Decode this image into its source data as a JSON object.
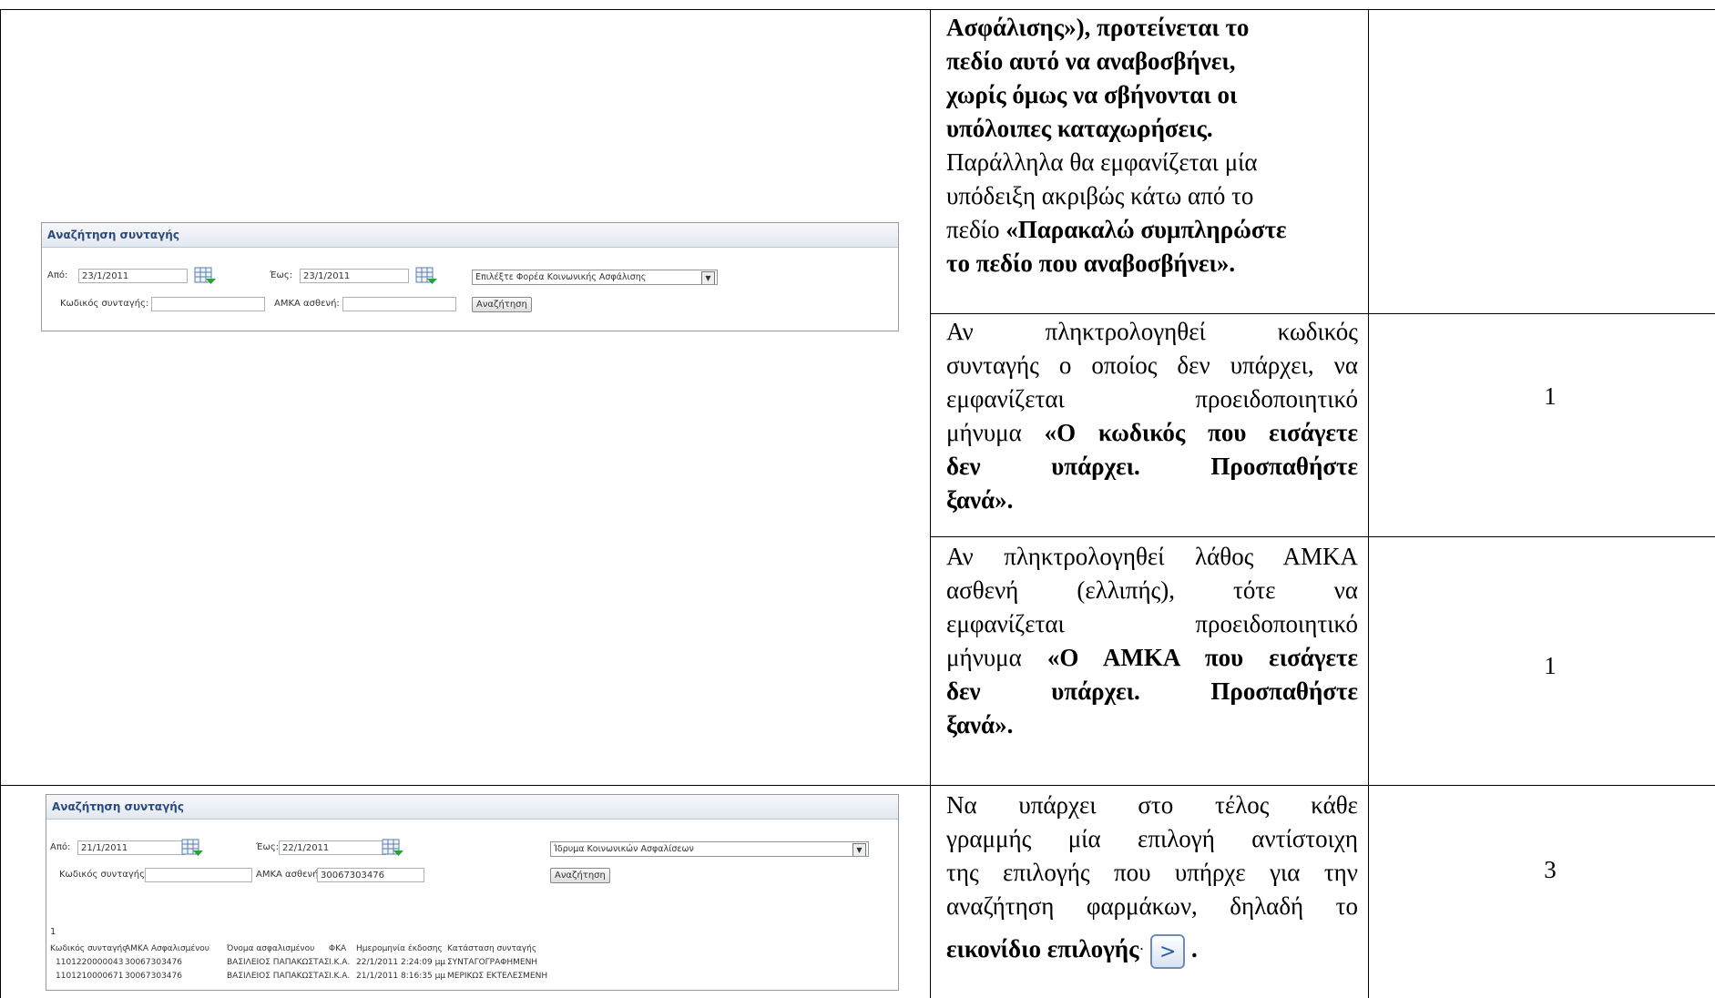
{
  "row1": {
    "text_lines": [
      {
        "b": "Ασφάλισης»), προτείνεται το"
      },
      {
        "b": "πεδίο αυτό να αναβοσβήνει,"
      },
      {
        "b": "χωρίς όμως να σβήνονται οι"
      },
      {
        "b": "υπόλοιπες καταχωρήσεις."
      },
      {
        "t": "Παράλληλα θα εμφανίζεται μία"
      },
      {
        "t": "υπόδειξη ακριβώς κάτω από το"
      }
    ],
    "line7_plain": "πεδίο ",
    "line7_bold": "«Παρακαλώ συμπληρώστε",
    "line8_bold": "το πεδίο που αναβοσβήνει».",
    "number": ""
  },
  "search_form_1": {
    "title": "Αναζήτηση συνταγής",
    "from_label": "Από:",
    "from_value": "23/1/2011",
    "to_label": "Έως:",
    "to_value": "23/1/2011",
    "fund_select": "Επιλέξτε Φορέα Κοινωνικής Ασφάλισης",
    "code_label": "Κωδικός συνταγής:",
    "code_value": "",
    "amka_label": "ΑΜΚΑ ασθενή:",
    "amka_value": "",
    "search_button": "Αναζήτηση"
  },
  "row2": {
    "l1a": "Αν",
    "l1b": "πληκτρολογηθεί",
    "l1c": "κωδικός",
    "l2": "συνταγής ο οποίος δεν υπάρχει, να",
    "l3a": "εμφανίζεται",
    "l3b": "προειδοποιητικό",
    "l4_plain": "μήνυμα ",
    "l4_bold": "«Ο κωδικός που εισάγετε",
    "l5a": "δεν",
    "l5b": "υπάρχει.",
    "l5c": "Προσπαθήστε",
    "l6": "ξανά».",
    "number": "1"
  },
  "row3": {
    "l1": "Αν πληκτρολογηθεί λάθος ΑΜΚΑ",
    "l2a": "ασθενή",
    "l2b": "(ελλιπής),",
    "l2c": "τότε",
    "l2d": "να",
    "l3a": "εμφανίζεται",
    "l3b": "προειδοποιητικό",
    "l4_plain": "μήνυμα ",
    "l4_bold": "«Ο ΑΜΚΑ που εισάγετε",
    "l5a": "δεν",
    "l5b": "υπάρχει.",
    "l5c": "Προσπαθήστε",
    "l6": "ξανά».",
    "number": "1"
  },
  "search_form_2": {
    "title": "Αναζήτηση συνταγής",
    "from_label": "Από:",
    "from_value": "21/1/2011",
    "to_label": "Έως:",
    "to_value": "22/1/2011",
    "fund_select": "Ίδρυμα Κοινωνικών Ασφαλίσεων",
    "code_label": "Κωδικός συνταγής:",
    "code_value": "",
    "amka_label": "ΑΜΚΑ ασθενή:",
    "amka_value": "30067303476",
    "search_button": "Αναζήτηση",
    "page_number": "1",
    "columns": [
      "Κωδικός συνταγής",
      "ΑΜΚΑ Ασφαλισμένου",
      "Όνομα ασφαλισμένου",
      "ΦΚΑ",
      "Ημερομηνία έκδοσης",
      "Κατάσταση συνταγής"
    ],
    "rows": [
      [
        "1101220000043",
        "30067303476",
        "ΒΑΣΙΛΕΙΟΣ ΠΑΠΑΚΩΣΤΑΣ",
        "Ι.Κ.Α.",
        "22/1/2011 2:24:09 μμ",
        "ΣΥΝΤΑΓΟΓΡΑΦΗΜΕΝΗ"
      ],
      [
        "1101210000671",
        "30067303476",
        "ΒΑΣΙΛΕΙΟΣ ΠΑΠΑΚΩΣΤΑΣ",
        "Ι.Κ.Α.",
        "21/1/2011 8:16:35 μμ",
        "ΜΕΡΙΚΩΣ ΕΚΤΕΛΕΣΜΕΝΗ"
      ]
    ]
  },
  "row4": {
    "l1a": "Να",
    "l1b": "υπάρχει",
    "l1c": "στο",
    "l1d": "τέλος",
    "l1e": "κάθε",
    "l2": "γραμμής μία επιλογή αντίστοιχη",
    "l3": "της επιλογής που υπήρχε για την",
    "l4": "αναζήτηση φαρμάκων, δηλαδή το",
    "l5_bold": "εικονίδιο επιλογής",
    "l5_colon": "·",
    "select_icon": ">",
    "l5_end": ".",
    "number": "3"
  }
}
